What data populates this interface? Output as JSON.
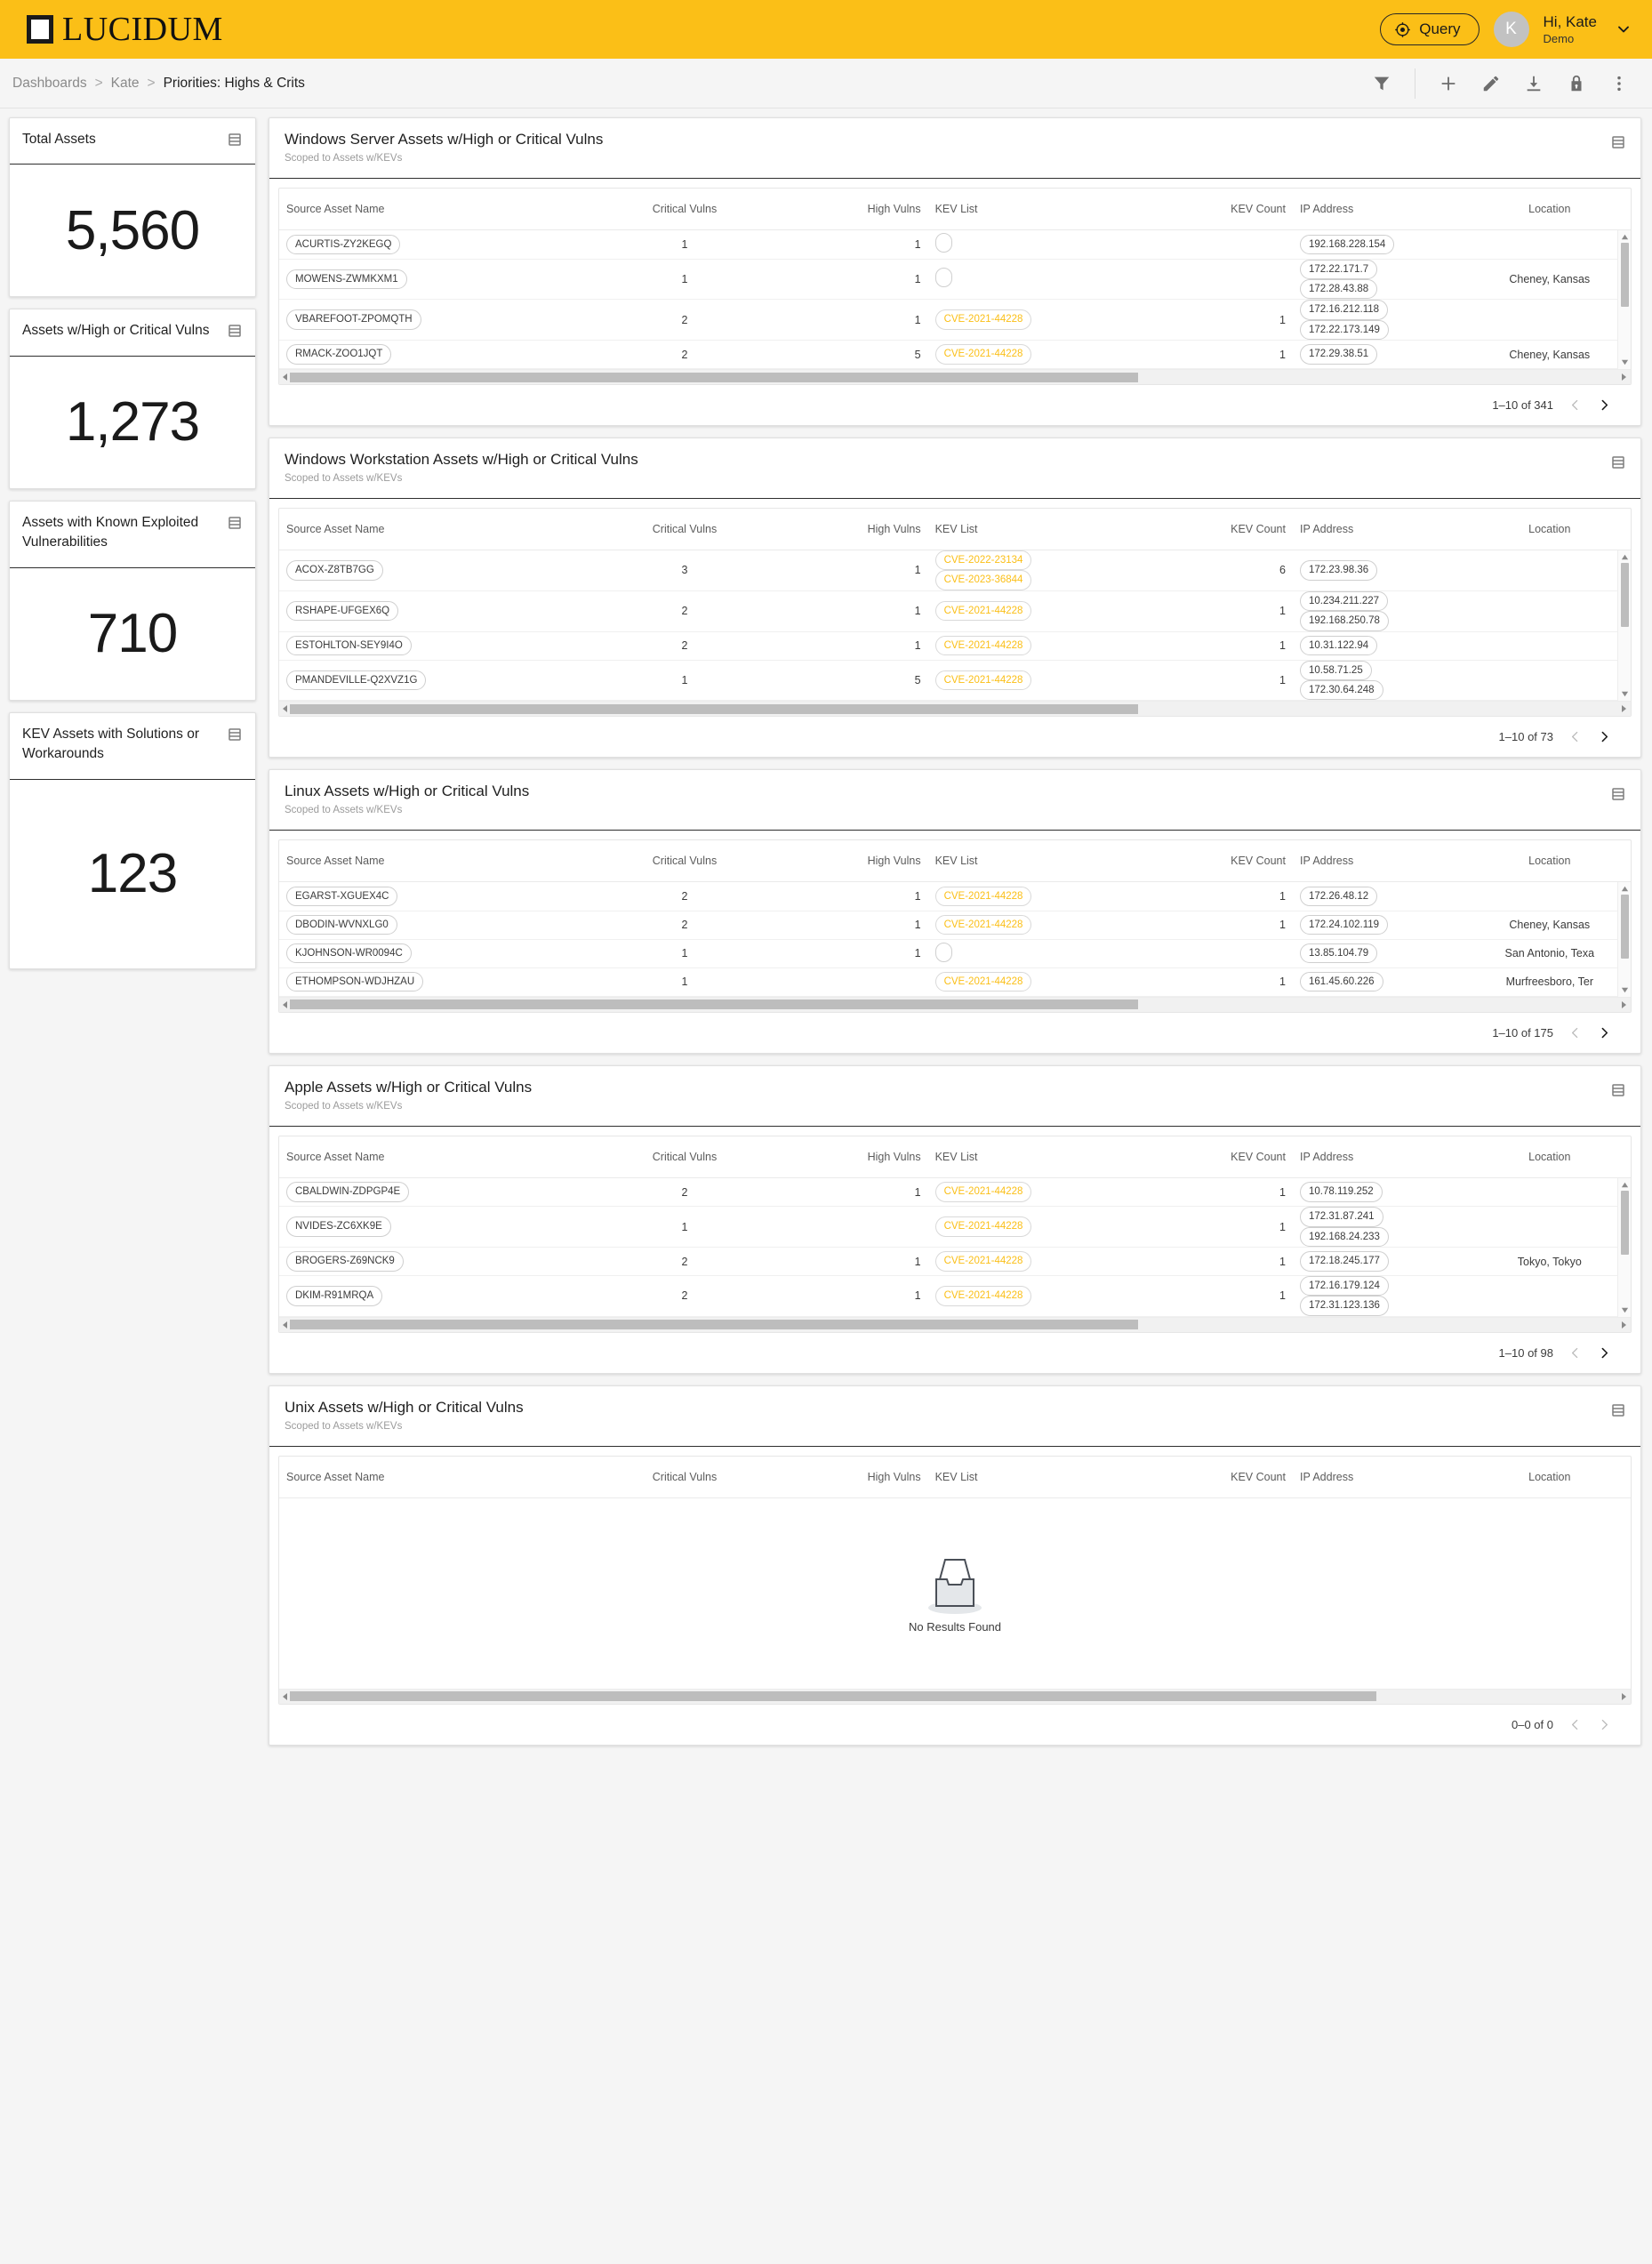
{
  "brand": {
    "name": "LUCIDUM",
    "bar_color": "#FBBF17"
  },
  "topbar": {
    "query_label": "Query",
    "avatar_initial": "K",
    "greeting": "Hi, Kate",
    "org": "Demo"
  },
  "breadcrumb": {
    "items": [
      "Dashboards",
      "Kate"
    ],
    "separator": ">",
    "current": "Priorities: Highs & Crits"
  },
  "toolbar": {
    "icons": [
      "filter-icon",
      "plus-icon",
      "pencil-icon",
      "download-icon",
      "lock-icon",
      "more-vertical-icon"
    ]
  },
  "kpis": [
    {
      "title": "Total Assets",
      "value": "5,560"
    },
    {
      "title": "Assets w/High or Critical Vulns",
      "value": "1,273"
    },
    {
      "title": "Assets with Known Exploited Vulnerabilities",
      "value": "710"
    },
    {
      "title": "KEV Assets with Solutions or Workarounds",
      "value": "123"
    }
  ],
  "table_columns": [
    "Source Asset Name",
    "Critical Vulns",
    "High Vulns",
    "KEV List",
    "KEV Count",
    "IP Address",
    "Location"
  ],
  "empty_label": "No Results Found",
  "widgets": [
    {
      "title": "Windows Server Assets w/High or Critical Vulns",
      "subtitle": "Scoped to Assets w/KEVs",
      "pager": "1–10 of 341",
      "rows": [
        {
          "name": "ACURTIS-ZY2KEGQ",
          "critical": "1",
          "high": "1",
          "kevs": [],
          "kev_count": "",
          "ips": [
            "192.168.228.154"
          ],
          "location": ""
        },
        {
          "name": "MOWENS-ZWMKXM1",
          "critical": "1",
          "high": "1",
          "kevs": [],
          "kev_count": "",
          "ips": [
            "172.22.171.7",
            "172.28.43.88"
          ],
          "location": "Cheney, Kansas"
        },
        {
          "name": "VBAREFOOT-ZPOMQTH",
          "critical": "2",
          "high": "1",
          "kevs": [
            "CVE-2021-44228"
          ],
          "kev_count": "1",
          "ips": [
            "172.16.212.118",
            "172.22.173.149"
          ],
          "location": ""
        },
        {
          "name": "RMACK-ZOO1JQT",
          "critical": "2",
          "high": "5",
          "kevs": [
            "CVE-2021-44228"
          ],
          "kev_count": "1",
          "ips": [
            "172.29.38.51"
          ],
          "location": "Cheney, Kansas"
        }
      ]
    },
    {
      "title": "Windows Workstation Assets w/High or Critical Vulns",
      "subtitle": "Scoped to Assets w/KEVs",
      "pager": "1–10 of 73",
      "rows": [
        {
          "name": "ACOX-Z8TB7GG",
          "critical": "3",
          "high": "1",
          "kevs": [
            "CVE-2022-23134",
            "CVE-2023-36844"
          ],
          "kev_count": "6",
          "ips": [
            "172.23.98.36"
          ],
          "location": ""
        },
        {
          "name": "RSHAPE-UFGEX6Q",
          "critical": "2",
          "high": "1",
          "kevs": [
            "CVE-2021-44228"
          ],
          "kev_count": "1",
          "ips": [
            "10.234.211.227",
            "192.168.250.78"
          ],
          "location": ""
        },
        {
          "name": "ESTOHLTON-SEY9I4O",
          "critical": "2",
          "high": "1",
          "kevs": [
            "CVE-2021-44228"
          ],
          "kev_count": "1",
          "ips": [
            "10.31.122.94"
          ],
          "location": ""
        },
        {
          "name": "PMANDEVILLE-Q2XVZ1G",
          "critical": "1",
          "high": "5",
          "kevs": [
            "CVE-2021-44228"
          ],
          "kev_count": "1",
          "ips": [
            "10.58.71.25",
            "172.30.64.248"
          ],
          "location": ""
        }
      ]
    },
    {
      "title": "Linux Assets w/High or Critical Vulns",
      "subtitle": "Scoped to Assets w/KEVs",
      "pager": "1–10 of 175",
      "rows": [
        {
          "name": "EGARST-XGUEX4C",
          "critical": "2",
          "high": "1",
          "kevs": [
            "CVE-2021-44228"
          ],
          "kev_count": "1",
          "ips": [
            "172.26.48.12"
          ],
          "location": ""
        },
        {
          "name": "DBODIN-WVNXLG0",
          "critical": "2",
          "high": "1",
          "kevs": [
            "CVE-2021-44228"
          ],
          "kev_count": "1",
          "ips": [
            "172.24.102.119"
          ],
          "location": "Cheney, Kansas"
        },
        {
          "name": "KJOHNSON-WR0094C",
          "critical": "1",
          "high": "1",
          "kevs": [],
          "kev_count": "",
          "ips": [
            "13.85.104.79"
          ],
          "location": "San Antonio, Texa"
        },
        {
          "name": "ETHOMPSON-WDJHZAU",
          "critical": "1",
          "high": "",
          "kevs": [
            "CVE-2021-44228"
          ],
          "kev_count": "1",
          "ips": [
            "161.45.60.226"
          ],
          "location": "Murfreesboro, Ter"
        }
      ]
    },
    {
      "title": "Apple Assets w/High or Critical Vulns",
      "subtitle": "Scoped to Assets w/KEVs",
      "pager": "1–10 of 98",
      "rows": [
        {
          "name": "CBALDWIN-ZDPGP4E",
          "critical": "2",
          "high": "1",
          "kevs": [
            "CVE-2021-44228"
          ],
          "kev_count": "1",
          "ips": [
            "10.78.119.252"
          ],
          "location": ""
        },
        {
          "name": "NVIDES-ZC6XK9E",
          "critical": "1",
          "high": "",
          "kevs": [
            "CVE-2021-44228"
          ],
          "kev_count": "1",
          "ips": [
            "172.31.87.241",
            "192.168.24.233"
          ],
          "location": ""
        },
        {
          "name": "BROGERS-Z69NCK9",
          "critical": "2",
          "high": "1",
          "kevs": [
            "CVE-2021-44228"
          ],
          "kev_count": "1",
          "ips": [
            "172.18.245.177"
          ],
          "location": "Tokyo, Tokyo"
        },
        {
          "name": "DKIM-R91MRQA",
          "critical": "2",
          "high": "1",
          "kevs": [
            "CVE-2021-44228"
          ],
          "kev_count": "1",
          "ips": [
            "172.16.179.124",
            "172.31.123.136"
          ],
          "location": ""
        }
      ]
    },
    {
      "title": "Unix Assets w/High or Critical Vulns",
      "subtitle": "Scoped to Assets w/KEVs",
      "pager": "0–0 of 0",
      "rows": []
    }
  ]
}
